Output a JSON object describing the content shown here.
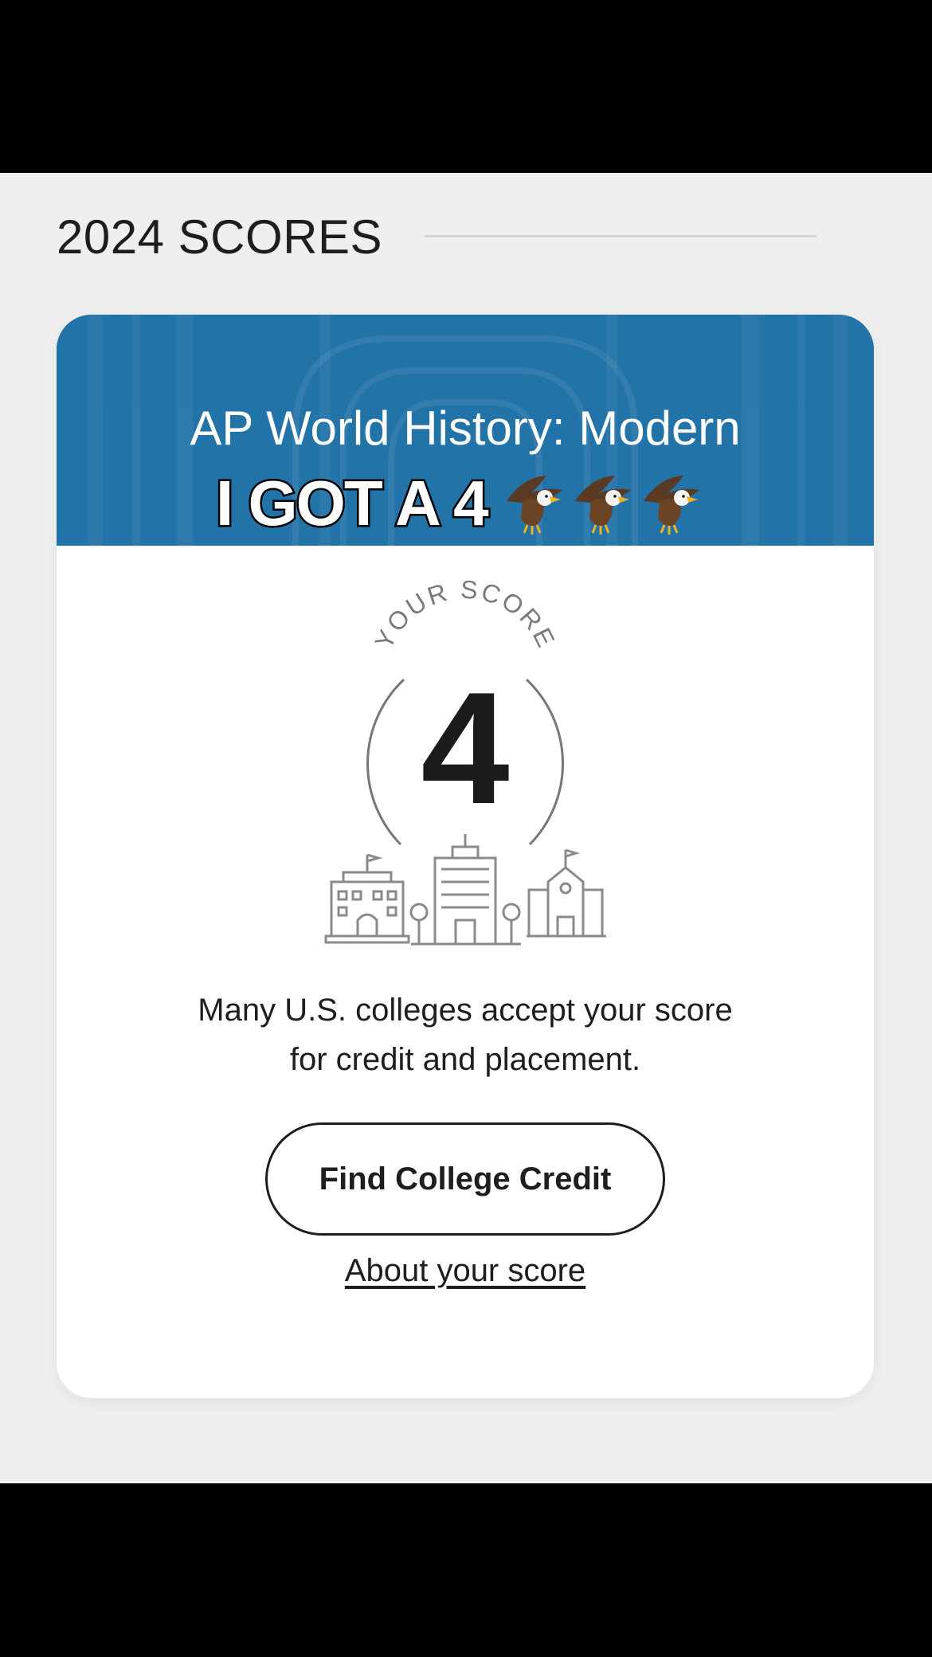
{
  "section": {
    "title": "2024 SCORES"
  },
  "card": {
    "subject": "AP World History: Modern",
    "overlay_caption": "I GOT A 4",
    "overlay_emoji": [
      "eagle-icon",
      "eagle-icon",
      "eagle-icon"
    ],
    "header_color": "#2374a9",
    "score_label": "YOUR SCORE",
    "score": "4",
    "message": "Many U.S. colleges accept your score for credit and placement.",
    "cta_label": "Find College Credit",
    "link_label": "About your score"
  }
}
